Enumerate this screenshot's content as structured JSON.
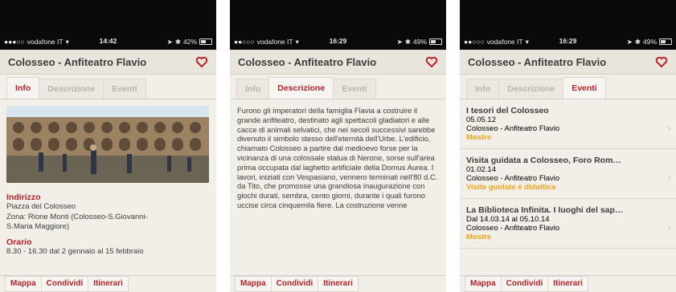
{
  "common": {
    "carrier": "vodafone IT",
    "title": "Colosseo - Anfiteatro Flavio",
    "tabs": [
      "Info",
      "Descrizione",
      "Eventi"
    ],
    "bottom_buttons": [
      "Mappa",
      "Condividi",
      "Itinerari"
    ],
    "accent_color": "#b7222a",
    "category_color": "#f2a41a"
  },
  "screen1": {
    "time": "14:42",
    "battery": "42%",
    "address_label": "Indirizzo",
    "address_lines": [
      "Piazza del Colosseo",
      "Zona: Rione Monti (Colosseo-S.Giovanni-",
      "S.Maria Maggiore)"
    ],
    "hours_label": "Orario",
    "hours_line": "8.30 - 16.30 dal 2 gennaio al 15 febbraio"
  },
  "screen2": {
    "time": "16:29",
    "battery": "49%",
    "description": "Furono gli imperatori della famiglia Flavia a costruire il grande anfiteatro, destinato agli spettacoli gladiatori e alle cacce di animali selvatici, che nei secoli successivi sarebbe divenuto il simbolo stesso dell'eternità dell'Urbe. L'edificio, chiamato Colosseo a partire dal medioevo forse per la vicinanza di una colossale statua di Nerone, sorse sull'area prima occupata dal laghetto artificiale della Domus Aurea. I lavori, iniziati con Vespasiano, vennero terminati nell'80 d.C. da Tito, che promosse una grandiosa inaugurazione con giochi durati, sembra, cento giorni, durante i quali furono uccise circa cinquemila fiere. La costruzione venne"
  },
  "screen3": {
    "time": "16:29",
    "battery": "49%",
    "events": [
      {
        "title": "I tesori del Colosseo",
        "date": "05.05.12",
        "place": "Colosseo - Anfiteatro Flavio",
        "category": "Mostre"
      },
      {
        "title": "Visita guidata a Colosseo, Foro Rom…",
        "date": "01.02.14",
        "place": "Colosseo - Anfiteatro Flavio",
        "category": "Visite guidate e didattica"
      },
      {
        "title": "La Biblioteca Infinita. I luoghi del sap…",
        "date": "Dal 14.03.14 al 05.10.14",
        "place": "Colosseo - Anfiteatro Flavio",
        "category": "Mostre"
      }
    ]
  }
}
